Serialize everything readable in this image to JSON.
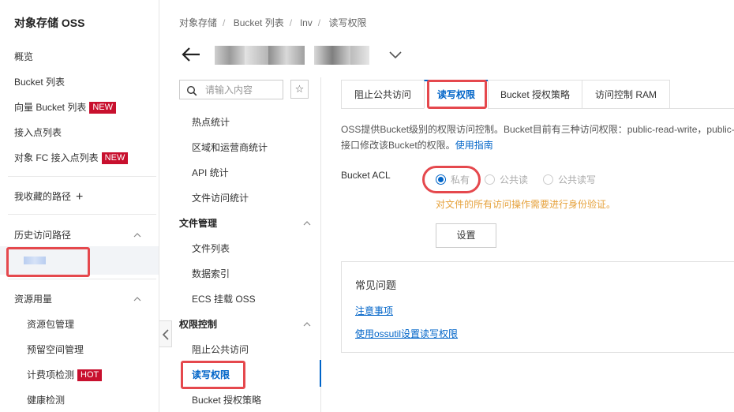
{
  "sidebar": {
    "title": "对象存储 OSS",
    "items": [
      {
        "label": "概览"
      },
      {
        "label": "Bucket 列表"
      },
      {
        "label": "向量 Bucket 列表",
        "badge": "NEW"
      },
      {
        "label": "接入点列表"
      },
      {
        "label": "对象 FC 接入点列表",
        "badge": "NEW"
      }
    ],
    "favorites_label": "我收藏的路径",
    "favorites_add": "+",
    "history_label": "历史访问路径",
    "resource_label": "资源用量",
    "resource_items": [
      {
        "label": "资源包管理"
      },
      {
        "label": "预留空间管理"
      },
      {
        "label": "计费项检测",
        "badge": "HOT"
      },
      {
        "label": "健康检测"
      }
    ]
  },
  "breadcrumb": [
    "对象存储",
    "Bucket 列表",
    "lnv",
    "读写权限"
  ],
  "midnav": {
    "search_placeholder": "请输入内容",
    "star": "☆",
    "items_top": [
      "热点统计",
      "区域和运营商统计",
      "API 统计",
      "文件访问统计"
    ],
    "group_files": "文件管理",
    "items_files": [
      "文件列表",
      "数据索引",
      "ECS 挂载 OSS"
    ],
    "group_perm": "权限控制",
    "items_perm": [
      "阻止公共访问",
      "读写权限",
      "Bucket 授权策略"
    ]
  },
  "tabs": [
    "阻止公共访问",
    "读写权限",
    "Bucket 授权策略",
    "访问控制 RAM"
  ],
  "description": {
    "line1": "OSS提供Bucket级别的权限访问控制。Bucket目前有三种访问权限：public-read-write，public-read，private。",
    "line2_text": "接口修改该Bucket的权限。",
    "line2_link": "使用指南"
  },
  "acl": {
    "label": "Bucket ACL",
    "options": [
      "私有",
      "公共读",
      "公共读写"
    ],
    "selected": "私有",
    "warning": "对文件的所有访问操作需要进行身份验证。",
    "button": "设置"
  },
  "faq": {
    "title": "常见问题",
    "links": [
      "注意事项",
      "使用ossutil设置读写权限"
    ]
  },
  "colors": {
    "accent": "#0064c8",
    "badge": "#c8102e",
    "warning": "#e6a23c",
    "highlight": "#e5484d"
  }
}
